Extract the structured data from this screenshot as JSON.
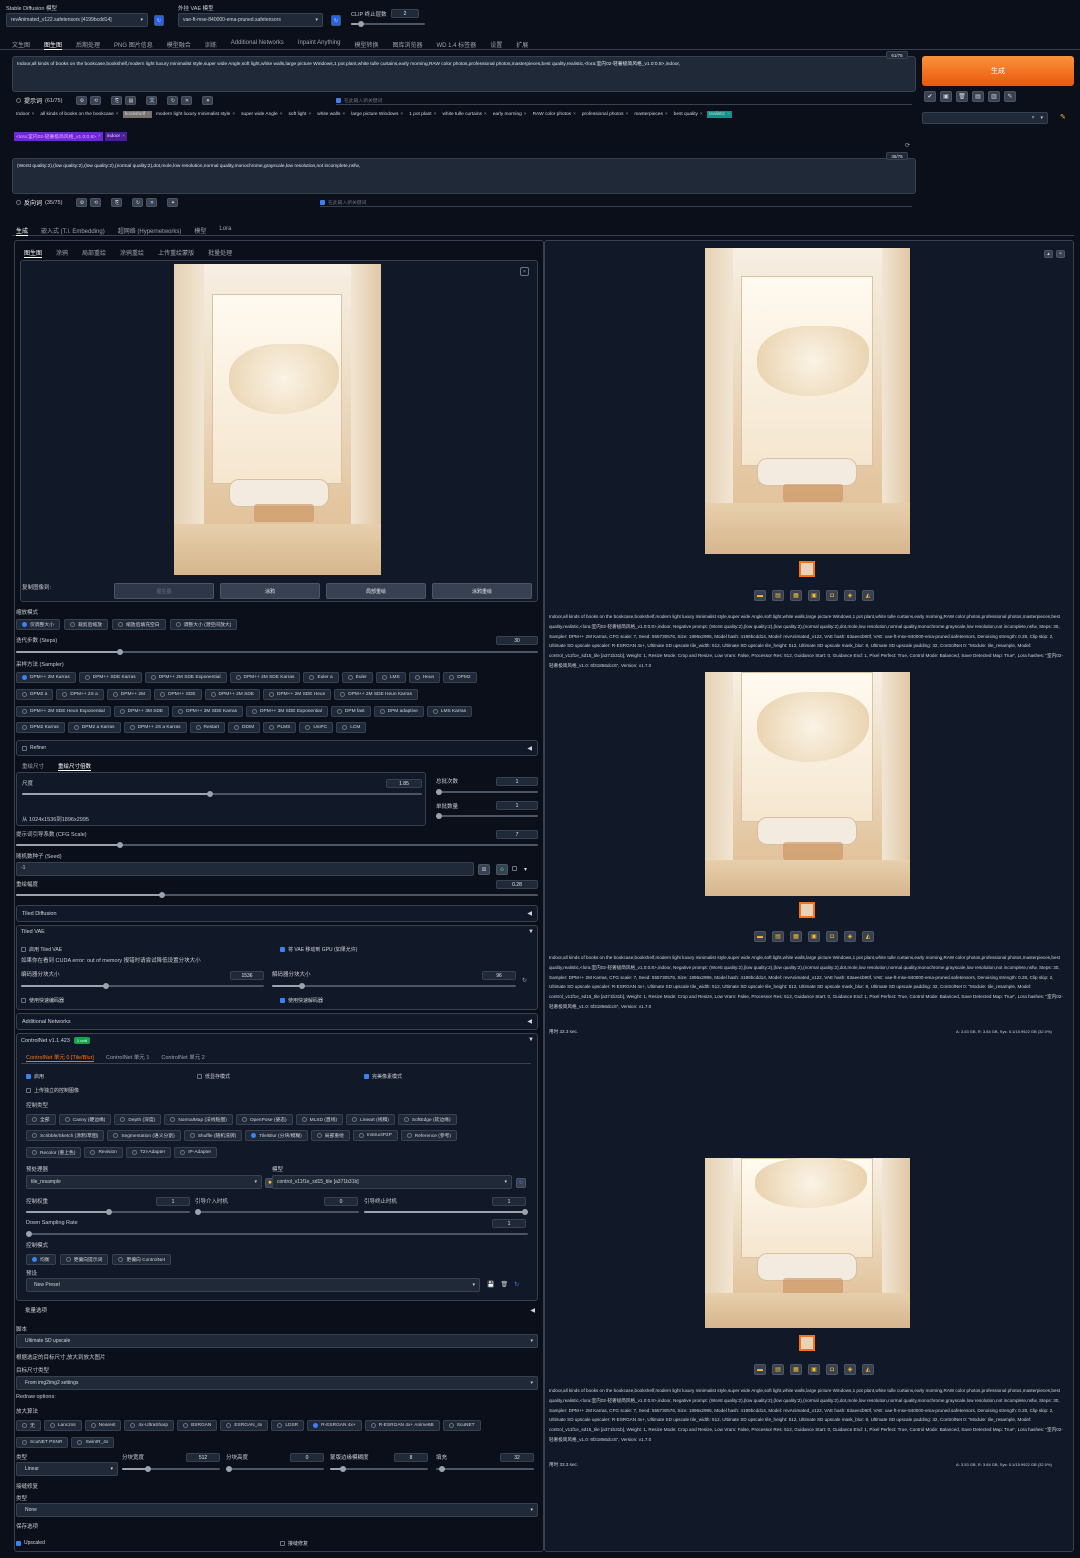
{
  "top": {
    "model_label": "Stable Diffusion 模型",
    "model_value": "revAnimated_v122.safetensors [4199bcdd14]",
    "vae_label": "外挂 VAE 模型",
    "vae_value": "vae-ft-mse-840000-ema-pruned.safetensors",
    "clip_label": "CLIP 终止层数",
    "clip_value": "2"
  },
  "main_tabs": [
    "文生图",
    "图生图",
    "后期处理",
    "PNG 图片信息",
    "模型融合",
    "训练",
    "Additional Networks",
    "Inpaint Anything",
    "模型转换",
    "图库浏览器",
    "WD 1.4 标签器",
    "设置",
    "扩展"
  ],
  "prompt": {
    "text": "Indoor,all kinds of books on the bookcase,bookshelf,modern light luxury minimalist style,super wide Angle,soft light,white walls,large picture Windows,1 pot plant,white tulle curtains,early morning,RAW color photos,professional photos,masterpieces,best quality,realistic,<lora:室内02-轻奢极简风格_v1.0:0.8>,indoor,",
    "counter": "61/75",
    "label": "提示词",
    "label_count": "(61/75)",
    "input_placeholder": "在此输入新关键词",
    "chips": [
      "Indoor",
      "all kinds of books on the bookcase",
      "bookshelf",
      "modern light luxury minimalist style",
      "super wide Angle",
      "soft light",
      "white walls",
      "large picture Windows",
      "1 pot plant",
      "white tulle curtains",
      "early morning",
      "RAW color photos",
      "professional photos",
      "masterpieces",
      "best quality",
      "realistic"
    ],
    "chips_row2": [
      "<lora:室内02-轻奢极简风格_v1.0:0.8>",
      "indoor"
    ]
  },
  "negative": {
    "text": "(Worst quality:2),(low quality:2),(low quality:2),(normal quality:2),dot,mole,low resolution,normal quality,monochrome,grayscale,low resolution,not incomplete,nsfw,",
    "counter": "35/75",
    "label": "反向词",
    "label_count": "(35/75)",
    "input_placeholder": "在此输入新关键词"
  },
  "generate": {
    "label": "生成"
  },
  "sub_tabs": [
    "生成",
    "嵌入式 (T.I. Embedding)",
    "超网络 (Hypernetworks)",
    "模型",
    "Lora"
  ],
  "img_tabs": [
    "图生图",
    "涂鸦",
    "局部重绘",
    "涂鸦重绘",
    "上传重绘蒙版",
    "批量处理"
  ],
  "copy_label": "复制图像到:",
  "copy_buttons": [
    "图生图",
    "涂鸦",
    "局部重绘",
    "涂鸦重绘"
  ],
  "resize": {
    "label": "缩放模式",
    "options": [
      "仅调整大小",
      "裁剪后缩放",
      "缩放后填充空白",
      "调整大小 (潜空间放大)"
    ]
  },
  "steps": {
    "label": "迭代步数 (Steps)",
    "value": "30",
    "fraction": 0.2
  },
  "sampler": {
    "label": "采样方法 (Sampler)",
    "row1": [
      "DPM++ 2M Karras",
      "DPM++ SDE Karras",
      "DPM++ 2M SDE Exponential",
      "DPM++ 2M SDE Karras",
      "Euler a",
      "Euler",
      "LMS",
      "Heun",
      "DPM2"
    ],
    "row2": [
      "DPM2 a",
      "DPM++ 2S a",
      "DPM++ 2M",
      "DPM++ SDE",
      "DPM++ 2M SDE",
      "DPM++ 2M SDE Heun",
      "DPM++ 2M SDE Heun Karras"
    ],
    "row3": [
      "DPM++ 2M SDE Heun Exponential",
      "DPM++ 3M SDE",
      "DPM++ 3M SDE Karras",
      "DPM++ 3M SDE Exponential",
      "DPM fast",
      "DPM adaptive",
      "LMS Karras"
    ],
    "row4": [
      "DPM2 Karras",
      "DPM2 a Karras",
      "DPM++ 2S a Karras",
      "Restart",
      "DDIM",
      "PLMS",
      "UniPC",
      "LCM"
    ]
  },
  "refiner": {
    "label": "Refiner"
  },
  "size_tabs": [
    "重绘尺寸",
    "重绘尺寸倍数"
  ],
  "scale": {
    "label": "尺度",
    "value": "1.85",
    "fraction": 0.47
  },
  "size_note": "从 1024x1536到1896x2995",
  "batch_count": {
    "label": "总批次数",
    "value": "1"
  },
  "batch_size": {
    "label": "单批数量",
    "value": "1"
  },
  "cfg": {
    "label": "提示词引导系数 (CFG Scale)",
    "value": "7",
    "fraction": 0.2
  },
  "seed": {
    "label": "随机数种子 (Seed)",
    "value": "-1"
  },
  "denoise": {
    "label": "重绘幅度",
    "value": "0.28",
    "fraction": 0.28
  },
  "tiled_diffusion": {
    "label": "Tiled Diffusion"
  },
  "tiled_vae": {
    "label": "Tiled VAE",
    "enable": "启用 Tiled VAE",
    "move_vae": "将 VAE 移动到 GPU (如果允许)",
    "warning": "如果你在看到 CUDA error: out of memory 报错时请尝试降低设置分块大小",
    "encoder_label": "编码器分块大小",
    "encoder_value": "1536",
    "decoder_label": "解码器分块大小",
    "decoder_value": "96",
    "fast_encoder": "使用快速编码器",
    "fast_decoder": "使用快速解码器"
  },
  "additional_networks": {
    "label": "Additional Networks"
  },
  "controlnet": {
    "label": "ControlNet v1.1.423",
    "badge": "1 unit",
    "unit_tabs": [
      "ControlNet 单元 0 [Tile/Blur]",
      "ControlNet 单元 1",
      "ControlNet 单元 2"
    ],
    "enable": "启用",
    "low_vram": "低显存模式",
    "pixel_perfect": "完美像素模式",
    "upload_independent": "上传独立的控制图像",
    "control_type_label": "控制类型",
    "types_row1": [
      "全部",
      "Canny (硬边缘)",
      "Depth (深度)",
      "NormalMap (法线贴图)",
      "OpenPose (姿态)",
      "MLSD (直线)",
      "Lineart (线稿)",
      "SoftEdge (软边缘)"
    ],
    "types_row2": [
      "Scribble/Sketch (涂鸦/草图)",
      "Segmentation (语义分割)",
      "Shuffle (随机洗牌)",
      "Tile/Blur (分块/模糊)",
      "局部重绘",
      "InstructP2P",
      "Reference (参考)"
    ],
    "types_row3": [
      "Recolor (重上色)",
      "Revision",
      "T2I-Adapter",
      "IP-Adapter"
    ],
    "preprocessor_label": "预处理器",
    "preprocessor_value": "tile_resample",
    "model_label": "模型",
    "model_value": "control_v11f1e_sd15_tile [a371b31b]",
    "weight_label": "控制权重",
    "weight_value": "1",
    "start_label": "引导介入时机",
    "start_value": "0",
    "end_label": "引导终止时机",
    "end_value": "1",
    "down_label": "Down Sampling Rate",
    "down_value": "1",
    "mode_label": "控制模式",
    "modes": [
      "均衡",
      "更偏向提示词",
      "更偏向 ControlNet"
    ],
    "preset_label": "预设",
    "preset_value": "New Preset"
  },
  "batch_options": {
    "label": "批量选项"
  },
  "script": {
    "label": "脚本",
    "value": "Ultimate SD upscale",
    "note": "根据选定的目标尺寸,放大到放大图片",
    "target_label": "目标尺寸类型",
    "target_value": "From img2img2 settings",
    "redraw_label": "Redraw options:",
    "upscaler_label": "放大算法",
    "upscalers_row1": [
      "无",
      "Lanczos",
      "Nearest",
      "4x-UltraSharp",
      "BSRGAN",
      "ESRGAN_4x",
      "LDSR",
      "R-ESRGAN 4x+",
      "R-ESRGAN 4x+ Anime6B",
      "ScuNET"
    ],
    "upscalers_row2": [
      "ScuNET PSNR",
      "SwinIR_4x"
    ],
    "type_label": "类型",
    "type_value": "Linear",
    "tile_w_label": "分块宽度",
    "tile_w_value": "512",
    "tile_h_label": "分块高度",
    "tile_h_value": "0",
    "mask_blur_label": "蒙版边缘模糊度",
    "mask_blur_value": "8",
    "padding_label": "填充",
    "padding_value": "32",
    "seams_label": "接缝修复",
    "seams_type_label": "类型",
    "seams_value": "None",
    "save_label": "保存选项",
    "upscaled": "Upscaled",
    "seams_fix": "接缝修复"
  },
  "outputs": [
    {
      "info": "Indoor,all kinds of books on the bookcase,bookshelf,modern light luxury minimalist style,super wide Angle,soft light,white walls,large picture Windows,1 pot plant,white tulle curtains,early morning,RAW color photos,professional photos,masterpieces,best quality,realistic,<lora:室内02-轻奢极简风格_v1.0:0.8>,indoor, Negative prompt: (Worst quality:2),(low quality:2),(low quality:2),(normal quality:2),dot,mole,low resolution,normal quality,monochrome,grayscale,low resolution,not incomplete,nsfw, Steps: 30, Sampler: DPM++ 2M Karras, CFG scale: 7, Seed: 555730576, Size: 1896x2995, Model hash: 4199bcdd14, Model: revAnimated_v122, VAE hash: 63aeecb90f, VAE: vae-ft-mse-840000-ema-pruned.safetensors, Denoising strength: 0.28, Clip skip: 2, Ultimate SD upscale upscaler: R-ESRGAN 4x+, Ultimate SD upscale tile_width: 512, Ultimate SD upscale tile_height: 512, Ultimate SD upscale mask_blur: 8, Ultimate SD upscale padding: 32, ControlNet 0: \"Module: tile_resample, Model: control_v11f1e_sd15_tile [a371b31b], Weight: 1, Resize Mode: Crop and Resize, Low Vram: False, Processor Res: 512, Guidance Start: 0, Guidance End: 1, Pixel Perfect: True, Control Mode: Balanced, Save Detected Map: True\", Lora hashes: \"室内02-轻奢极简风格_v1.0: 6f31856dcc5\", Version: v1.7.0"
    },
    {
      "info": "Indoor,all kinds of books on the bookcase,bookshelf,modern light luxury minimalist style,super wide Angle,soft light,white walls,large picture Windows,1 pot plant,white tulle curtains,early morning,RAW color photos,professional photos,masterpieces,best quality,realistic,<lora:室内02-轻奢极简风格_v1.0:0.8>,indoor, Negative prompt: (Worst quality:2),(low quality:2),(low quality:2),(normal quality:2),dot,mole,low resolution,normal quality,monochrome,grayscale,low resolution,not incomplete,nsfw, Steps: 30, Sampler: DPM++ 2M Karras, CFG scale: 7, Seed: 555730576, Size: 1896x2995, Model hash: 4199bcdd14, Model: revAnimated_v122, VAE hash: 63aeecb90f, VAE: vae-ft-mse-840000-ema-pruned.safetensors, Denoising strength: 0.28, Clip skip: 2, Ultimate SD upscale upscaler: R-ESRGAN 4x+, Ultimate SD upscale tile_width: 512, Ultimate SD upscale tile_height: 512, Ultimate SD upscale mask_blur: 8, Ultimate SD upscale padding: 32, ControlNet 0: \"Module: tile_resample, Model: control_v11f1e_sd15_tile [a371b31b], Weight: 1, Resize Mode: Crop and Resize, Low Vram: False, Processor Res: 512, Guidance Start: 0, Guidance End: 1, Pixel Perfect: True, Control Mode: Balanced, Save Detected Map: True\", Lora hashes: \"室内02-轻奢极简风格_v1.0: 6f31856dcc5\", Version: v1.7.0",
      "time": "用时 33.3 sec.",
      "mem": "A: 3.53 GB, R: 3.84 GB, Sys: 5.1/15.9922 GB (32.0%)"
    },
    {
      "info": "Indoor,all kinds of books on the bookcase,bookshelf,modern light luxury minimalist style,super wide Angle,soft light,white walls,large picture Windows,1 pot plant,white tulle curtains,early morning,RAW color photos,professional photos,masterpieces,best quality,realistic,<lora:室内02-轻奢极简风格_v1.0:0.8>,indoor, Negative prompt: (Worst quality:2),(low quality:2),(low quality:2),(normal quality:2),dot,mole,low resolution,normal quality,monochrome,grayscale,low resolution,not incomplete,nsfw, Steps: 30, Sampler: DPM++ 2M Karras, CFG scale: 7, Seed: 555730576, Size: 1896x2995, Model hash: 4199bcdd14, Model: revAnimated_v122, VAE hash: 63aeecb90f, VAE: vae-ft-mse-840000-ema-pruned.safetensors, Denoising strength: 0.28, Clip skip: 2, Ultimate SD upscale upscaler: R-ESRGAN 4x+, Ultimate SD upscale tile_width: 512, Ultimate SD upscale tile_height: 512, Ultimate SD upscale mask_blur: 8, Ultimate SD upscale padding: 32, ControlNet 0: \"Module: tile_resample, Model: control_v11f1e_sd15_tile [a371b31b], Weight: 1, Resize Mode: Crop and Resize, Low Vram: False, Processor Res: 512, Guidance Start: 0, Guidance End: 1, Pixel Perfect: True, Control Mode: Balanced, Save Detected Map: True\", Lora hashes: \"室内02-轻奢极简风格_v1.0: 6f31856dcc5\", Version: v1.7.0",
      "time": "用时 33.3 sec.",
      "mem": "A: 3.53 GB, R: 3.84 GB, Sys: 5.1/15.9922 GB (32.0%)"
    }
  ],
  "colors": {
    "accent": "#f97316",
    "bg": "#0b0f19",
    "panel": "#111827",
    "selected": "#3b82f6"
  }
}
